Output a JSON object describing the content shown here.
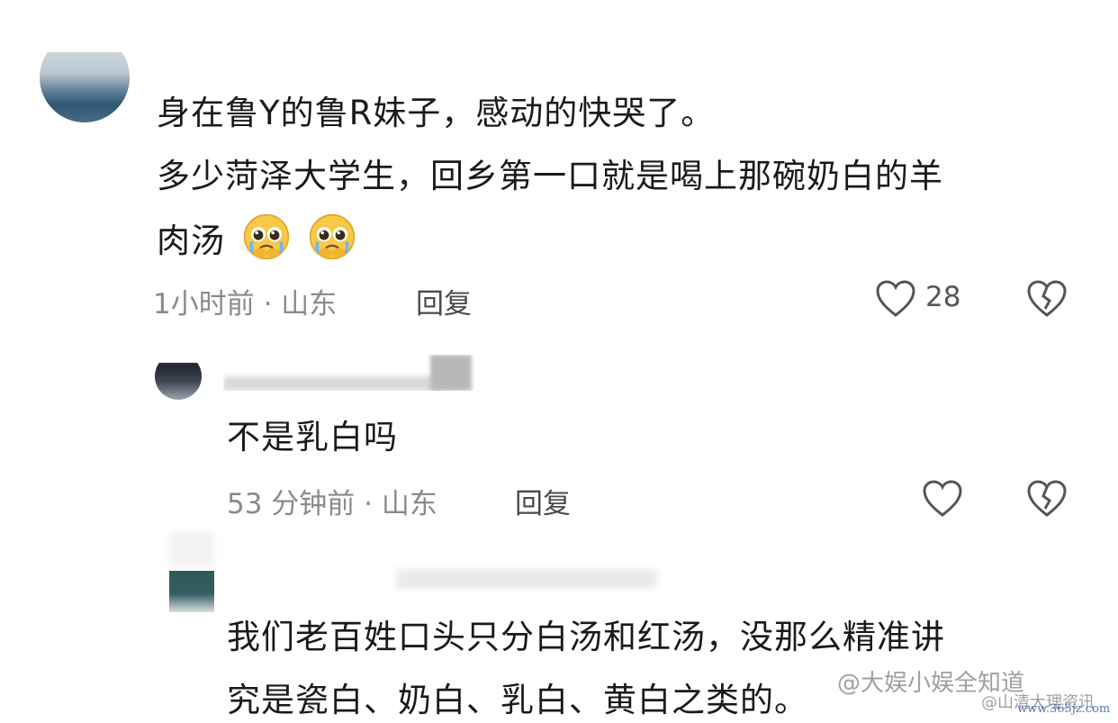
{
  "comment": {
    "line1": "身在鲁Y的鲁R妹子，感动的快哭了。",
    "line2": "多少菏泽大学生，回乡第一口就是喝上那碗奶白的羊",
    "line3": "肉汤",
    "emoji": "pleading-face-emoji",
    "meta": "1小时前 · 山东",
    "reply_label": "回复",
    "like_count": "28"
  },
  "reply1": {
    "text": "不是乳白吗",
    "meta": "53 分钟前 · 山东",
    "reply_label": "回复"
  },
  "reply2": {
    "line1": "我们老百姓口头只分白汤和红汤，没那么精准讲",
    "line2": "究是瓷白、奶白、乳白、黄白之类的。"
  },
  "watermark": {
    "main": "@大娱小娱全知道",
    "sub": "@山清大理资讯",
    "url": "www.365jz.com"
  },
  "colors": {
    "text": "#1a1a1a",
    "meta": "#8a8a8a",
    "emoji_face": "#f7c948"
  }
}
